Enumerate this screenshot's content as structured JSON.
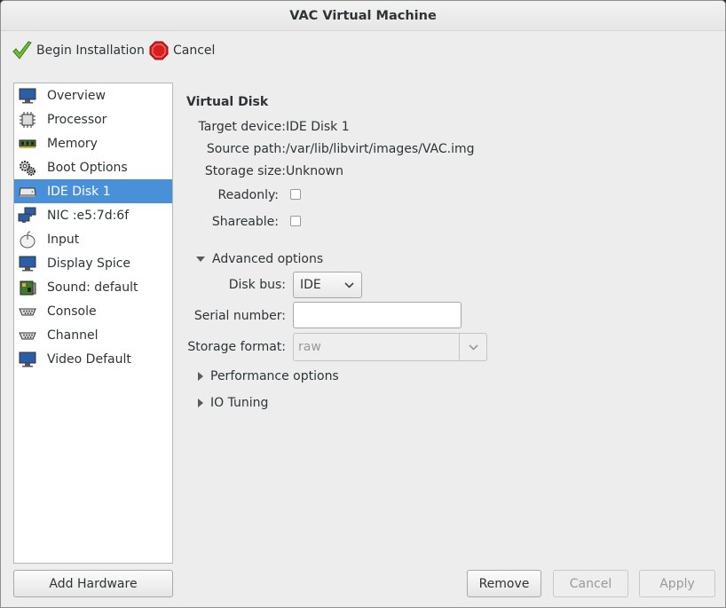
{
  "window": {
    "title": "VAC Virtual Machine"
  },
  "toolbar": {
    "begin_label": "Begin Installation",
    "cancel_label": "Cancel"
  },
  "sidebar": {
    "selected": "IDE Disk 1",
    "items": [
      {
        "label": "Overview",
        "icon": "monitor-icon"
      },
      {
        "label": "Processor",
        "icon": "cpu-chip-icon"
      },
      {
        "label": "Memory",
        "icon": "memory-module-icon"
      },
      {
        "label": "Boot Options",
        "icon": "gears-icon"
      },
      {
        "label": "IDE Disk 1",
        "icon": "hard-disk-icon"
      },
      {
        "label": "NIC :e5:7d:6f",
        "icon": "network-icon"
      },
      {
        "label": "Input",
        "icon": "mouse-icon"
      },
      {
        "label": "Display Spice",
        "icon": "monitor-icon"
      },
      {
        "label": "Sound: default",
        "icon": "sound-card-icon"
      },
      {
        "label": "Console",
        "icon": "serial-port-icon"
      },
      {
        "label": "Channel",
        "icon": "serial-port-icon"
      },
      {
        "label": "Video Default",
        "icon": "monitor-icon"
      }
    ]
  },
  "disk": {
    "section_title": "Virtual Disk",
    "target_device_label": "Target device:",
    "target_device": "IDE Disk 1",
    "source_path_label": "Source path:",
    "source_path": "/var/lib/libvirt/images/VAC.img",
    "storage_size_label": "Storage size:",
    "storage_size": "Unknown",
    "readonly_label": "Readonly:",
    "shareable_label": "Shareable:",
    "advanced_label": "Advanced options",
    "disk_bus_label": "Disk bus:",
    "disk_bus": "IDE",
    "serial_label": "Serial number:",
    "serial_value": "",
    "storage_format_label": "Storage format:",
    "storage_format": "raw",
    "performance_label": "Performance options",
    "io_tuning_label": "IO Tuning"
  },
  "buttons": {
    "add_hardware": "Add Hardware",
    "remove": "Remove",
    "cancel": "Cancel",
    "apply": "Apply"
  },
  "colors": {
    "selection": "#4a90d9",
    "window_bg": "#ededed"
  }
}
